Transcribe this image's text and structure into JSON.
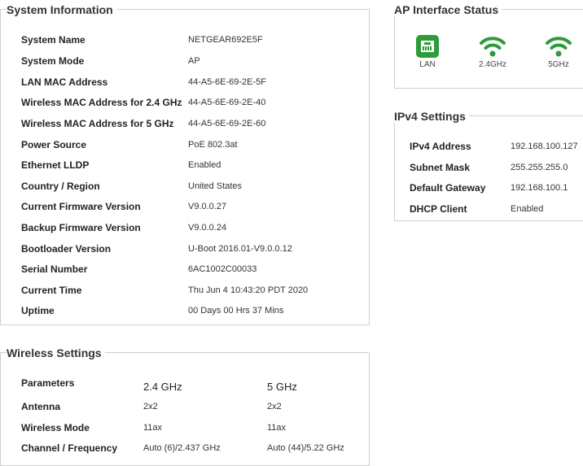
{
  "system_info": {
    "title": "System Information",
    "rows": [
      {
        "label": "System Name",
        "value": "NETGEAR692E5F"
      },
      {
        "label": "System Mode",
        "value": "AP"
      },
      {
        "label": "LAN MAC Address",
        "value": "44-A5-6E-69-2E-5F"
      },
      {
        "label": "Wireless MAC Address for 2.4 GHz",
        "value": "44-A5-6E-69-2E-40"
      },
      {
        "label": "Wireless MAC Address for 5 GHz",
        "value": "44-A5-6E-69-2E-60"
      },
      {
        "label": "Power Source",
        "value": "PoE 802.3at"
      },
      {
        "label": "Ethernet LLDP",
        "value": "Enabled"
      },
      {
        "label": "Country / Region",
        "value": "United States"
      },
      {
        "label": "Current Firmware Version",
        "value": "V9.0.0.27"
      },
      {
        "label": "Backup Firmware Version",
        "value": "V9.0.0.24"
      },
      {
        "label": "Bootloader Version",
        "value": "U-Boot 2016.01-V9.0.0.12"
      },
      {
        "label": "Serial Number",
        "value": "6AC1002C00033"
      },
      {
        "label": "Current Time",
        "value": "Thu Jun 4 10:43:20 PDT 2020"
      },
      {
        "label": "Uptime",
        "value": "00 Days 00 Hrs 37 Mins"
      }
    ]
  },
  "ap_status": {
    "title": "AP Interface Status",
    "items": [
      {
        "label": "LAN",
        "icon": "lan-port-icon"
      },
      {
        "label": "2.4GHz",
        "icon": "wifi-icon"
      },
      {
        "label": "5GHz",
        "icon": "wifi-icon"
      }
    ],
    "accent_color": "#2e9b3a"
  },
  "ipv4": {
    "title": "IPv4 Settings",
    "rows": [
      {
        "label": "IPv4 Address",
        "value": "192.168.100.127"
      },
      {
        "label": "Subnet Mask",
        "value": "255.255.255.0"
      },
      {
        "label": "Default Gateway",
        "value": "192.168.100.1"
      },
      {
        "label": "DHCP Client",
        "value": "Enabled"
      }
    ]
  },
  "wireless": {
    "title": "Wireless Settings",
    "headers": [
      "Parameters",
      "2.4 GHz",
      "5 GHz"
    ],
    "rows": [
      {
        "label": "Antenna",
        "v24": "2x2",
        "v5": "2x2"
      },
      {
        "label": "Wireless Mode",
        "v24": "11ax",
        "v5": "11ax"
      },
      {
        "label": "Channel / Frequency",
        "v24": "Auto (6)/2.437 GHz",
        "v5": "Auto (44)/5.22 GHz"
      }
    ]
  }
}
